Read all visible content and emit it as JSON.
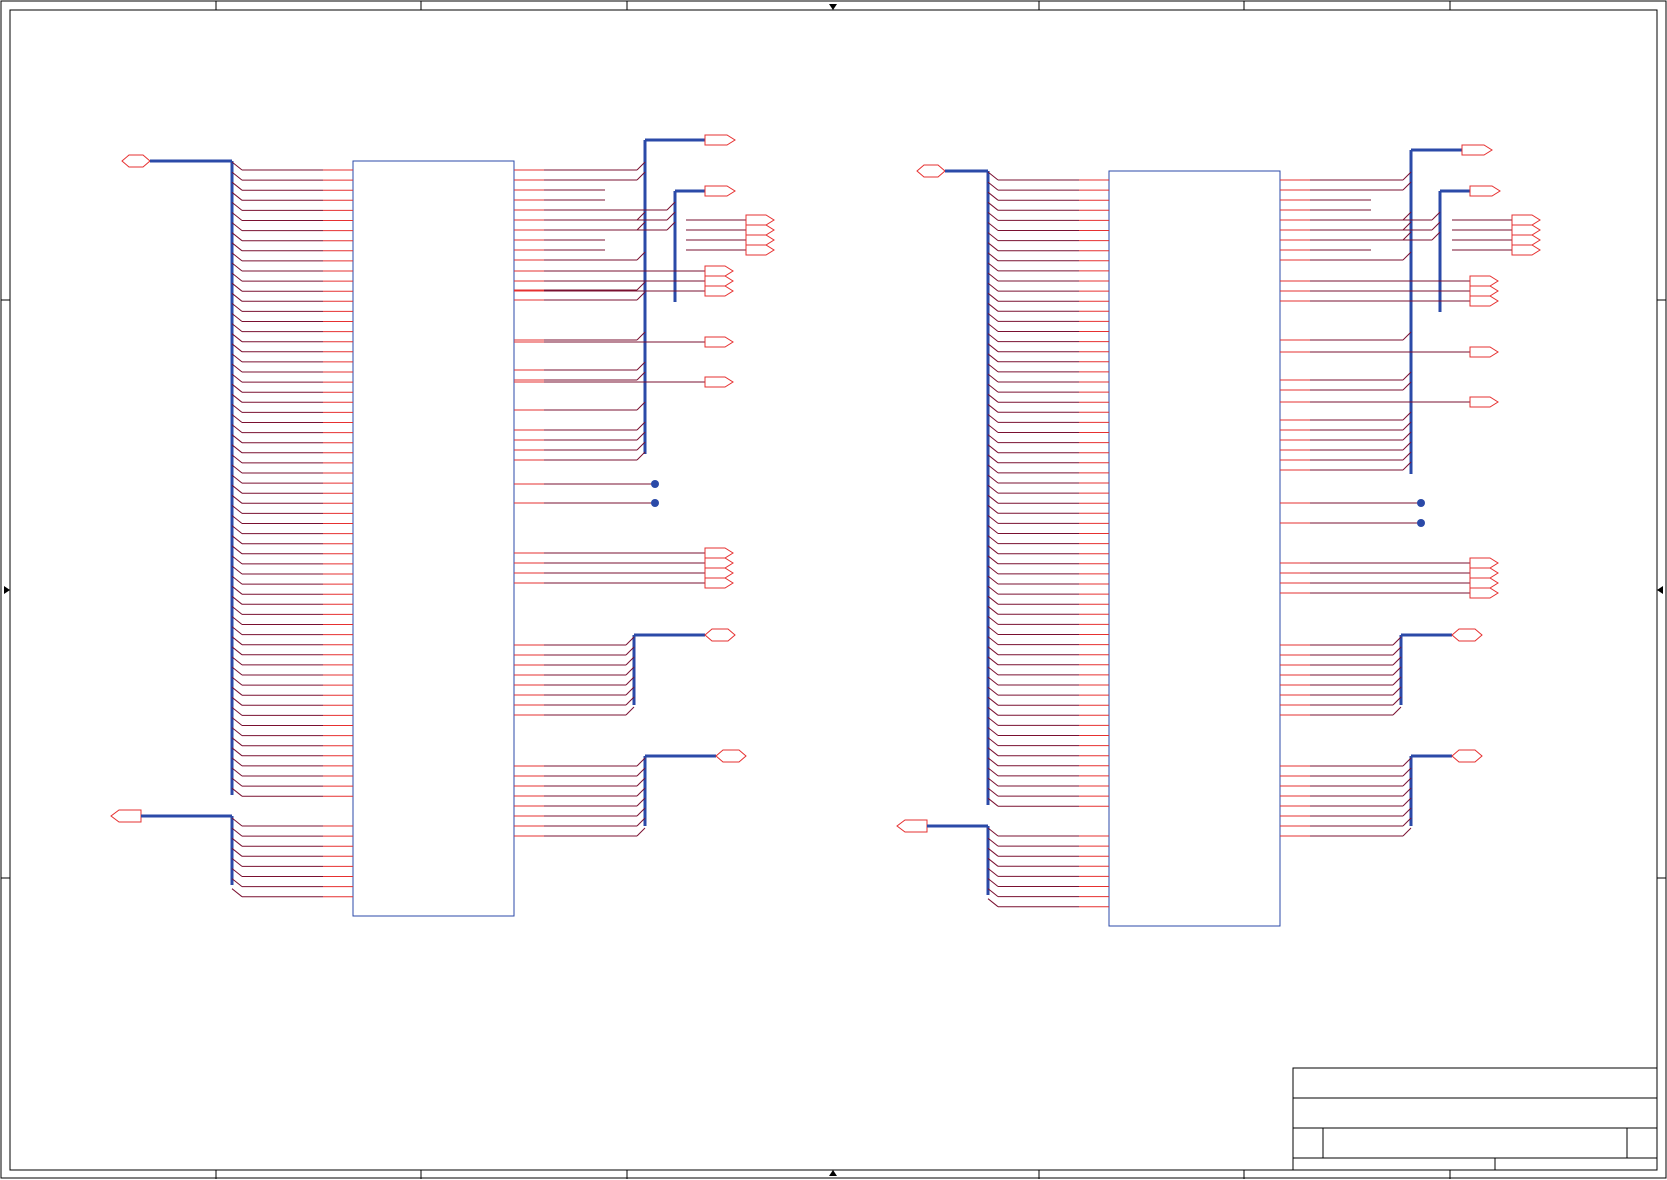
{
  "sheet": {
    "title_block_text": []
  },
  "colors": {
    "frame": "#000000",
    "wire": "#7a1030",
    "bus": "#2b4aa8",
    "pin": "#e63030",
    "port_outline": "#e63030",
    "body_outline": "#2b4aa8",
    "junction": "#2b4aa8",
    "background": "#ffffff"
  },
  "components": [
    {
      "id": "U1",
      "label": "",
      "left_pin_count": 74,
      "right_signal_groups": 12
    },
    {
      "id": "U2",
      "label": "",
      "left_pin_count": 74,
      "right_signal_groups": 12
    }
  ],
  "ports": [],
  "icons": {
    "hier_port": "hexagon-port-icon",
    "output_port": "arrow-flag-port-icon",
    "junction": "junction-dot-icon"
  }
}
